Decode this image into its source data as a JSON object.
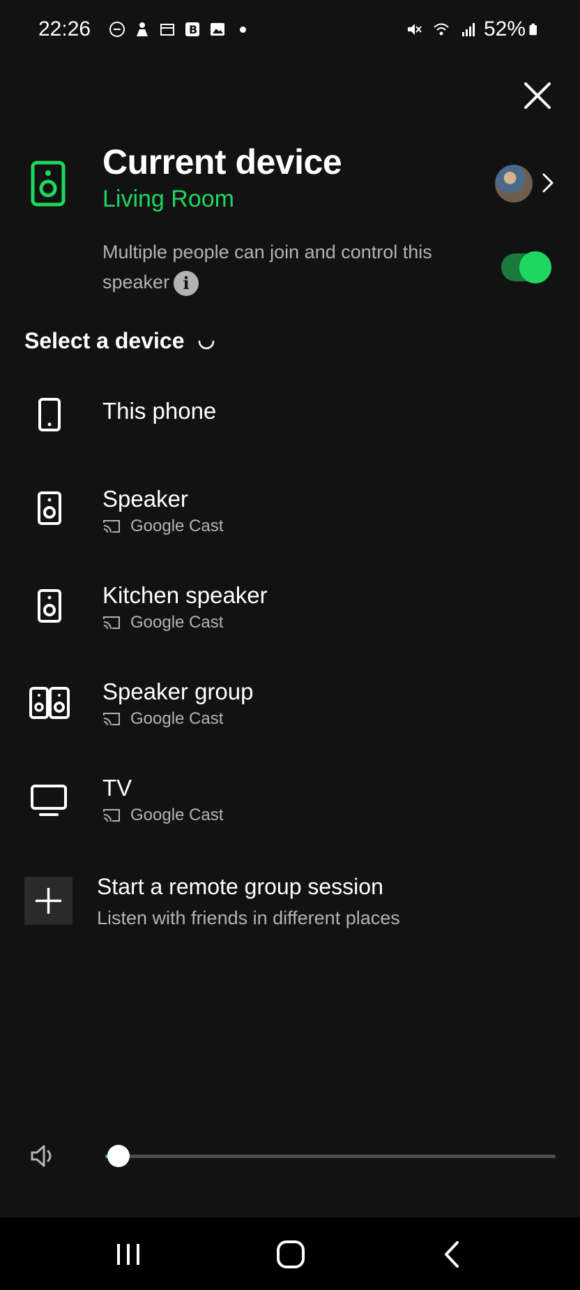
{
  "status_bar": {
    "time": "22:26",
    "battery": "52%"
  },
  "header": {
    "title": "Current device",
    "device_name": "Living Room",
    "jam_text": "Multiple people can join and control this speaker",
    "toggle_on": true
  },
  "section": {
    "title": "Select a device"
  },
  "devices": [
    {
      "name": "This phone",
      "sub": "",
      "icon": "phone-icon"
    },
    {
      "name": "Speaker",
      "sub": "Google Cast",
      "icon": "speaker-icon"
    },
    {
      "name": "Kitchen speaker",
      "sub": "Google Cast",
      "icon": "speaker-icon"
    },
    {
      "name": "Speaker group",
      "sub": "Google Cast",
      "icon": "speaker-group-icon"
    },
    {
      "name": "TV",
      "sub": "Google Cast",
      "icon": "tv-icon"
    }
  ],
  "remote": {
    "title": "Start a remote group session",
    "subtitle": "Listen with friends in different places"
  },
  "volume": {
    "level": 0.03
  },
  "colors": {
    "accent": "#1ed760",
    "background": "#121212",
    "secondary_text": "#b3b3b3"
  }
}
